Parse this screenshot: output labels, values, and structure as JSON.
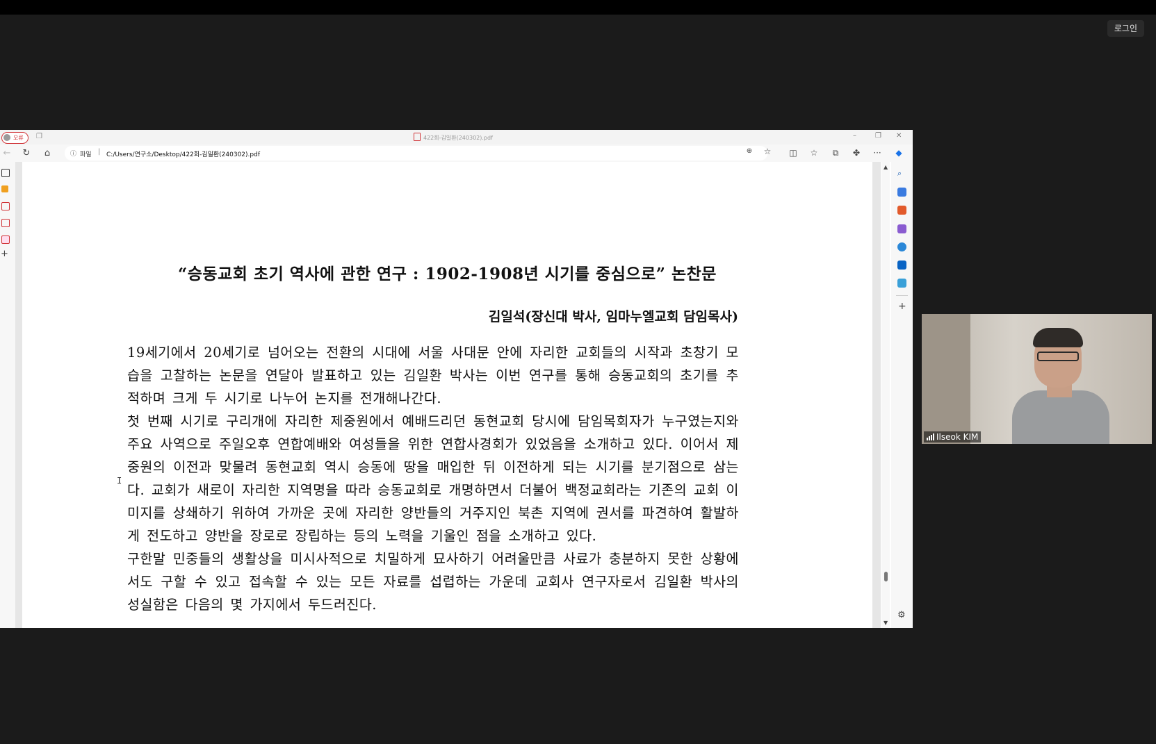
{
  "meeting": {
    "login_label": "로그인",
    "participant_name": "Ilseok KIM"
  },
  "browser": {
    "profile_label": "오류",
    "tab_title": "422회-김일환(240302).pdf",
    "url_scheme_label": "파일",
    "url": "C:/Users/연구소/Desktop/422회-김일환(240302).pdf",
    "accent_color": "#d13438"
  },
  "document": {
    "title": "“승동교회 초기 역사에 관한 연구 : 1902-1908년 시기를 중심으로” 논찬문",
    "author": "김일석(장신대 박사, 임마누엘교회 담임목사)",
    "paragraphs": [
      "19세기에서 20세기로 넘어오는 전환의 시대에 서울 사대문 안에 자리한 교회들의 시작과 초창기 모습을 고찰하는 논문을 연달아 발표하고 있는 김일환 박사는 이번 연구를 통해 승동교회의 초기를 추적하며 크게 두 시기로 나누어 논지를 전개해나간다.",
      "첫 번째 시기로 구리개에 자리한 제중원에서 예배드리던 동현교회 당시에 담임목회자가 누구였는지와 주요 사역으로 주일오후 연합예배와 여성들을 위한 연합사경회가 있었음을 소개하고 있다. 이어서 제중원의 이전과 맞물려 동현교회 역시 승동에 땅을 매입한 뒤 이전하게 되는 시기를 분기점으로 삼는다. 교회가 새로이 자리한 지역명을 따라 승동교회로 개명하면서 더불어 백정교회라는 기존의 교회 이미지를 상쇄하기 위하여 가까운 곳에 자리한 양반들의 거주지인 북촌 지역에 권서를 파견하여 활발하게 전도하고 양반을 장로로 장립하는 등의 노력을 기울인 점을 소개하고 있다.",
      "구한말 민중들의 생활상을 미시사적으로 치밀하게 묘사하기 어려울만큼 사료가 충분하지 못한 상황에서도 구할 수 있고 접속할 수 있는 모든 자료를 섭렵하는 가운데 교회사 연구자로서 김일환 박사의 성실함은 다음의 몇 가지에서 두드러진다."
    ]
  }
}
